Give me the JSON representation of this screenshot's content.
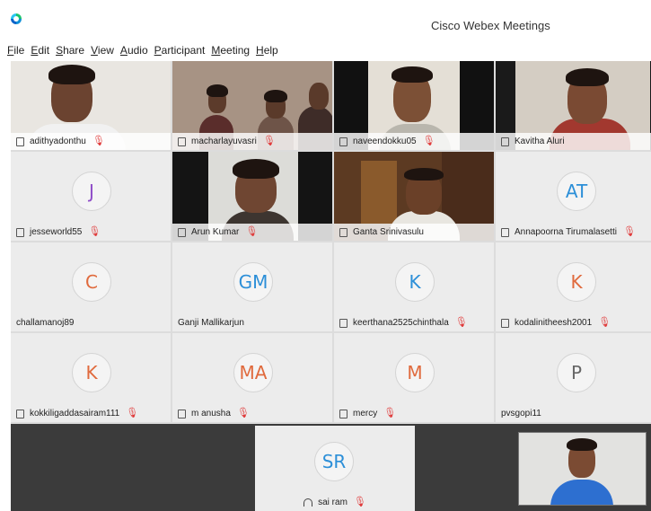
{
  "window": {
    "title": "Cisco Webex Meetings"
  },
  "menu": [
    "File",
    "Edit",
    "Share",
    "View",
    "Audio",
    "Participant",
    "Meeting",
    "Help"
  ],
  "colors": {
    "accent_blue": "#2c8fd8",
    "accent_orange": "#e06a3d",
    "accent_purple": "#8f4dc8",
    "mute_red": "#e03a3a"
  },
  "participants": [
    {
      "name": "adithyadonthu",
      "video": true,
      "muted": true,
      "icon": "screen-icon"
    },
    {
      "name": "macharlayuvasri",
      "video": true,
      "muted": true,
      "icon": "screen-icon"
    },
    {
      "name": "naveendokku05",
      "video": true,
      "muted": true,
      "icon": "screen-icon"
    },
    {
      "name": "Kavitha Aluri",
      "video": true,
      "muted": false,
      "icon": "screen-icon"
    },
    {
      "name": "jesseworld55",
      "initials": "J",
      "video": false,
      "muted": true,
      "icon": "screen-icon"
    },
    {
      "name": "Arun Kumar",
      "video": true,
      "muted": true,
      "icon": "screen-icon"
    },
    {
      "name": "Ganta Srinivasulu",
      "video": true,
      "muted": false,
      "icon": "screen-icon"
    },
    {
      "name": "Annapoorna Tirumalasetti",
      "initials": "AT",
      "video": false,
      "muted": true,
      "icon": "screen-icon"
    },
    {
      "name": "challamanoj89",
      "initials": "C",
      "video": false,
      "muted": false,
      "icon": ""
    },
    {
      "name": "Ganji Mallikarjun",
      "initials": "GM",
      "video": false,
      "muted": false,
      "icon": ""
    },
    {
      "name": "keerthana2525chinthala",
      "initials": "K",
      "video": false,
      "muted": true,
      "icon": "screen-icon"
    },
    {
      "name": "kodalinitheesh2001",
      "initials": "K",
      "video": false,
      "muted": true,
      "icon": "screen-icon"
    },
    {
      "name": "kokkiligaddasairam111",
      "initials": "K",
      "video": false,
      "muted": true,
      "icon": "screen-icon"
    },
    {
      "name": "m anusha",
      "initials": "MA",
      "video": false,
      "muted": true,
      "icon": "screen-icon"
    },
    {
      "name": "mercy",
      "initials": "M",
      "video": false,
      "muted": true,
      "icon": "screen-icon"
    },
    {
      "name": "pvsgopi11",
      "initials": "P",
      "video": false,
      "muted": false,
      "icon": ""
    }
  ],
  "active_speaker": {
    "name": "sai ram",
    "initials": "SR",
    "muted": true,
    "icon": "headset-icon"
  }
}
